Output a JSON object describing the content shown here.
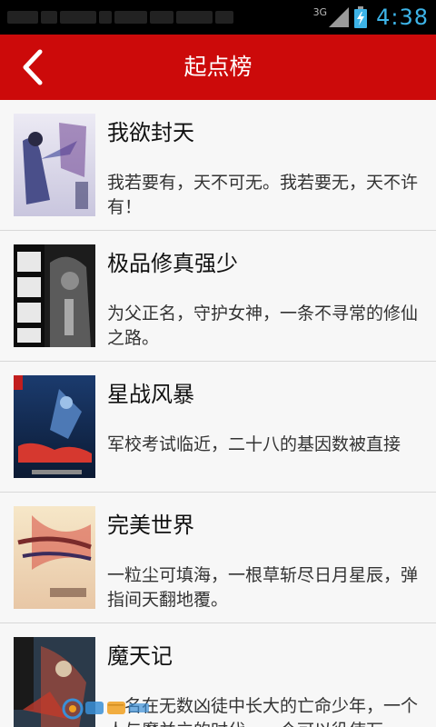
{
  "status_bar": {
    "network_type": "3G",
    "time": "4:38"
  },
  "header": {
    "title": "起点榜",
    "back_icon": "chevron-left-icon"
  },
  "books": [
    {
      "title": "我欲封天",
      "description": "我若要有，天不可无。我若要无，天不许有！"
    },
    {
      "title": "极品修真强少",
      "description": "为父正名，守护女神，一条不寻常的修仙之路。"
    },
    {
      "title": "星战风暴",
      "description": "军校考试临近，二十八的基因数被直接"
    },
    {
      "title": "完美世界",
      "description": "一粒尘可填海，一根草斩尽日月星辰，弹指间天翻地覆。"
    },
    {
      "title": "魔天记",
      "description": "一名在无数凶徒中长大的亡命少年，一个人与魔并立的时代，一个可以役使万"
    }
  ],
  "colors": {
    "accent": "#cc0a0a",
    "status_time": "#3db4e8"
  }
}
